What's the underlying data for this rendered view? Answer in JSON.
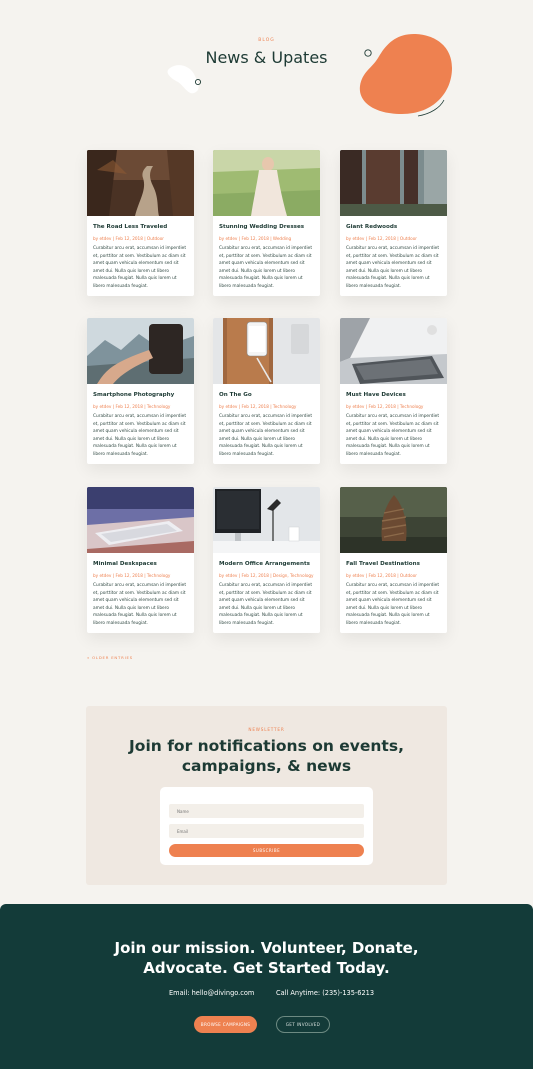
{
  "header": {
    "eyebrow": "BLOG",
    "title": "News & Upates"
  },
  "colors": {
    "accent": "#ee8150",
    "dark_green": "#133b39",
    "background": "#f5f3ef",
    "panel": "#efe8e1"
  },
  "posts": [
    {
      "title": "The Road Less Traveled",
      "meta": "by etdev | Feb 12, 2018 | Outdoor",
      "excerpt": "Curabitur arcu erat, accumsan id imperdiet et, porttitor at sem. Vestibulum ac diam sit amet quam vehicula elementum sed sit amet dui. Nulla quis lorem ut libero malesuada feugiat. Nulla quis lorem ut libero malesuada feugiat.",
      "image": "forest-road"
    },
    {
      "title": "Stunning Wedding Dresses",
      "meta": "by etdev | Feb 12, 2018 | Wedding",
      "excerpt": "Curabitur arcu erat, accumsan id imperdiet et, porttitor at sem. Vestibulum ac diam sit amet quam vehicula elementum sed sit amet dui. Nulla quis lorem ut libero malesuada feugiat. Nulla quis lorem ut libero malesuada feugiat.",
      "image": "wedding-field"
    },
    {
      "title": "Giant Redwoods",
      "meta": "by etdev | Feb 12, 2018 | Outdoor",
      "excerpt": "Curabitur arcu erat, accumsan id imperdiet et, porttitor at sem. Vestibulum ac diam sit amet quam vehicula elementum sed sit amet dui. Nulla quis lorem ut libero malesuada feugiat. Nulla quis lorem ut libero malesuada feugiat.",
      "image": "redwoods"
    },
    {
      "title": "Smartphone Photography",
      "meta": "by etdev | Feb 12, 2018 | Technology",
      "excerpt": "Curabitur arcu erat, accumsan id imperdiet et, porttitor at sem. Vestibulum ac diam sit amet quam vehicula elementum sed sit amet dui. Nulla quis lorem ut libero malesuada feugiat. Nulla quis lorem ut libero malesuada feugiat.",
      "image": "phone-mountains"
    },
    {
      "title": "On The Go",
      "meta": "by etdev | Feb 12, 2018 | Technology",
      "excerpt": "Curabitur arcu erat, accumsan id imperdiet et, porttitor at sem. Vestibulum ac diam sit amet quam vehicula elementum sed sit amet dui. Nulla quis lorem ut libero malesuada feugiat. Nulla quis lorem ut libero malesuada feugiat.",
      "image": "phone-leather"
    },
    {
      "title": "Must Have Devices",
      "meta": "by etdev | Feb 12, 2018 | Technology",
      "excerpt": "Curabitur arcu erat, accumsan id imperdiet et, porttitor at sem. Vestibulum ac diam sit amet quam vehicula elementum sed sit amet dui. Nulla quis lorem ut libero malesuada feugiat. Nulla quis lorem ut libero malesuada feugiat.",
      "image": "laptop"
    },
    {
      "title": "Minimal Deskspaces",
      "meta": "by etdev | Feb 12, 2018 | Technology",
      "excerpt": "Curabitur arcu erat, accumsan id imperdiet et, porttitor at sem. Vestibulum ac diam sit amet quam vehicula elementum sed sit amet dui. Nulla quis lorem ut libero malesuada feugiat. Nulla quis lorem ut libero malesuada feugiat.",
      "image": "keyboard"
    },
    {
      "title": "Modern Office Arrangements",
      "meta": "by etdev | Feb 12, 2018 | Design, Technology",
      "excerpt": "Curabitur arcu erat, accumsan id imperdiet et, porttitor at sem. Vestibulum ac diam sit amet quam vehicula elementum sed sit amet dui. Nulla quis lorem ut libero malesuada feugiat. Nulla quis lorem ut libero malesuada feugiat.",
      "image": "office-desk"
    },
    {
      "title": "Fall Travel Destinations",
      "meta": "by etdev | Feb 12, 2018 | Outdoor",
      "excerpt": "Curabitur arcu erat, accumsan id imperdiet et, porttitor at sem. Vestibulum ac diam sit amet quam vehicula elementum sed sit amet dui. Nulla quis lorem ut libero malesuada feugiat. Nulla quis lorem ut libero malesuada feugiat.",
      "image": "pinecone"
    }
  ],
  "pagination": {
    "older_label": "« OLDER ENTRIES"
  },
  "newsletter": {
    "eyebrow": "NEWSLETTER",
    "title_line1": "Join for notifications on events,",
    "title_line2": "campaigns, & news",
    "name_placeholder": "Name",
    "email_placeholder": "Email",
    "subscribe_label": "SUBSCRIBE"
  },
  "footer": {
    "title_line1": "Join our mission. Volunteer, Donate,",
    "title_line2": "Advocate. Get Started Today.",
    "email": "Email: hello@divingo.com",
    "phone": "Call Anytime: (235)-135-6213",
    "primary_button": "BROWSE CAMPAIGNS",
    "secondary_button": "GET INVOLVED"
  }
}
